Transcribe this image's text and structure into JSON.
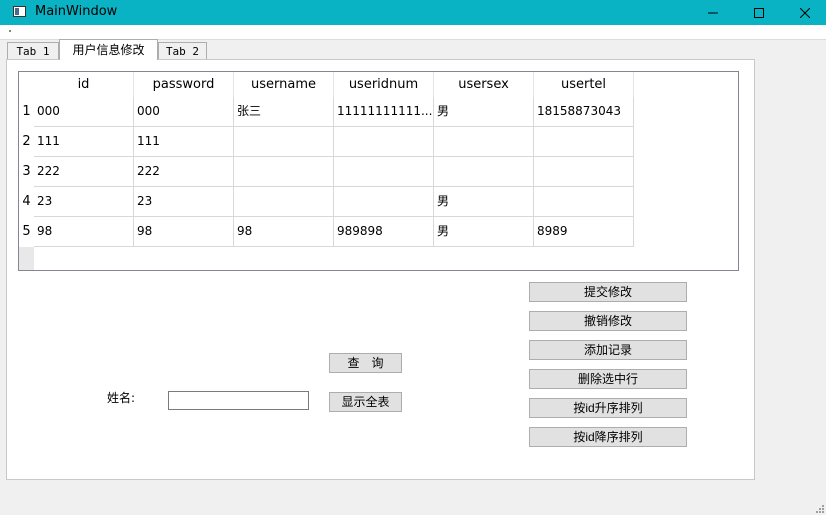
{
  "window": {
    "title": "MainWindow"
  },
  "tabs": [
    "Tab 1",
    "用户信息修改",
    "Tab 2"
  ],
  "table": {
    "columns": [
      "id",
      "password",
      "username",
      "useridnum",
      "usersex",
      "usertel"
    ],
    "row_numbers": [
      "1",
      "2",
      "3",
      "4",
      "5"
    ],
    "rows": [
      [
        "000",
        "000",
        "张三",
        "11111111111...",
        "男",
        "18158873043"
      ],
      [
        "111",
        "111",
        "",
        "",
        "",
        ""
      ],
      [
        "222",
        "222",
        "",
        "",
        "",
        ""
      ],
      [
        "23",
        "23",
        "",
        "",
        "男",
        ""
      ],
      [
        "98",
        "98",
        "98",
        "989898",
        "男",
        "8989"
      ]
    ]
  },
  "actions": {
    "submit": "提交修改",
    "revert": "撤销修改",
    "add": "添加记录",
    "delete": "删除选中行",
    "sort_asc": "按id升序排列",
    "sort_desc": "按id降序排列"
  },
  "search": {
    "query_button": "查　询",
    "show_all_button": "显示全表",
    "name_label": "姓名:",
    "name_value": ""
  },
  "colors": {
    "titlebar": "#0ab3c3",
    "button_bg": "#e1e1e1",
    "button_border": "#adadad"
  }
}
